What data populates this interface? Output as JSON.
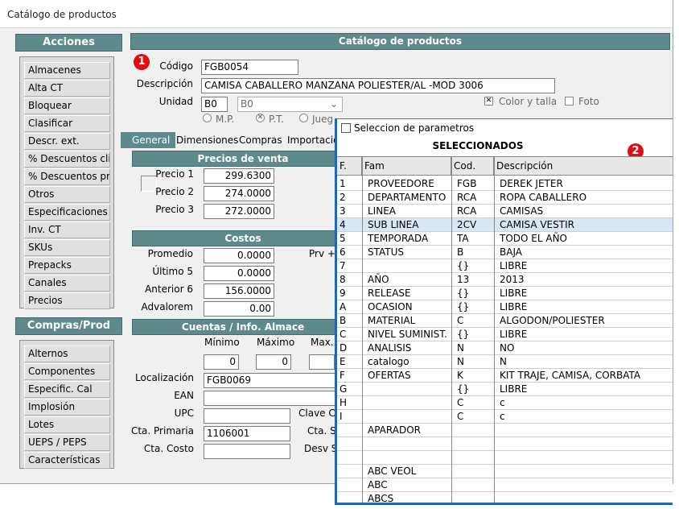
{
  "window": {
    "title": "Catálogo de productos"
  },
  "acciones": {
    "header": "Acciones",
    "items": [
      "Almacenes",
      "Alta CT",
      "Bloquear",
      "Clasificar",
      "Descr. ext.",
      "% Descuentos clis",
      "% Descuentos prvs",
      "Otros",
      "Especificaciones",
      "Inv. CT",
      "SKUs",
      "Prepacks",
      "Canales",
      "Precios"
    ]
  },
  "compras": {
    "header": "Compras/Prod",
    "items": [
      "Alternos",
      "Componentes",
      "Especific. Cal",
      "Implosión",
      "Lotes",
      "UEPS / PEPS",
      "Características"
    ]
  },
  "main": {
    "header": "Catálogo de productos",
    "badge1": "1",
    "codigo_label": "Código",
    "codigo_value": "FGB0054",
    "descripcion_label": "Descripción",
    "descripcion_value": "CAMISA CABALLERO MANZANA POLIESTER/AL  -MOD 3006",
    "unidad_label": "Unidad",
    "unidad_value": "B0",
    "unidad_select": "B0",
    "color_talla_label": "Color y talla",
    "foto_label": "Foto",
    "radio_mp": "M.P.",
    "radio_pt": "P.T.",
    "radio_jue": "Jueg"
  },
  "tabs": {
    "general": "General",
    "dimensiones": "Dimensiones",
    "compras": "Compras",
    "importacion": "Importació"
  },
  "precios": {
    "header": "Precios de venta",
    "labels": [
      "Precio 1",
      "Precio 2",
      "Precio 3"
    ],
    "values": [
      "299.6300",
      "274.0000",
      "272.0000"
    ]
  },
  "costos": {
    "header": "Costos",
    "labels": [
      "Promedio",
      "Último 5",
      "Anterior 6",
      "Advalorem"
    ],
    "values": [
      "0.0000",
      "0.0000",
      "156.0000",
      "0.00"
    ],
    "prv_label": "Prv +"
  },
  "cuentas": {
    "header": "Cuentas / Info. Almace",
    "minimo_label": "Mínimo",
    "maximo_label": "Máximo",
    "max_label": "Max.",
    "minimo_value": "0",
    "maximo_value": "0",
    "localizacion_label": "Localización",
    "localizacion_value": "FGB0069",
    "ean_label": "EAN",
    "upc_label": "UPC",
    "clave_label": "Clave CF",
    "cta_primaria_label": "Cta. Primaria",
    "cta_primaria_value": "1106001",
    "cta_se_label": "Cta. Se",
    "cta_costo_label": "Cta. Costo",
    "desv_label": "Desv St"
  },
  "popup": {
    "checkbox_label": "Seleccion de parametros",
    "title": "SELECCIONADOS",
    "badge2": "2",
    "columns": [
      "F.",
      "Fam",
      "Cod.",
      "Descripción"
    ],
    "rows": [
      [
        "1",
        "PROVEEDORE",
        "FGB",
        "DEREK JETER"
      ],
      [
        "2",
        "DEPARTAMENTO",
        "RCA",
        "ROPA CABALLERO"
      ],
      [
        "3",
        "LINEA",
        "RCA",
        "CAMISAS"
      ],
      [
        "4",
        "SUB LINEA",
        "2CV",
        "CAMISA VESTIR"
      ],
      [
        "5",
        "TEMPORADA",
        "TA",
        "TODO EL AÑO"
      ],
      [
        "6",
        "STATUS",
        "B",
        "BAJA"
      ],
      [
        "7",
        "",
        "{}",
        "LIBRE"
      ],
      [
        "8",
        "AÑO",
        "13",
        "2013"
      ],
      [
        "9",
        "RELEASE",
        "{}",
        "LIBRE"
      ],
      [
        "A",
        "OCASION",
        "{}",
        "LIBRE"
      ],
      [
        "B",
        "MATERIAL",
        "C",
        "ALGODON/POLIESTER"
      ],
      [
        "C",
        "NIVEL SUMINIST.",
        "{}",
        "LIBRE"
      ],
      [
        "D",
        "ANALISIS",
        "N",
        "NO"
      ],
      [
        "E",
        "catalogo",
        "N",
        "N"
      ],
      [
        "F",
        "OFERTAS",
        "K",
        "KIT TRAJE, CAMISA, CORBATA"
      ],
      [
        "G",
        "",
        "{}",
        "LIBRE"
      ],
      [
        "H",
        "",
        "C",
        "c"
      ],
      [
        "I",
        "",
        "C",
        "c"
      ],
      [
        "",
        "APARADOR",
        "",
        ""
      ],
      [
        "",
        "",
        "",
        ""
      ],
      [
        "",
        "",
        "",
        ""
      ],
      [
        "",
        "ABC VEOL",
        "",
        ""
      ],
      [
        "",
        "ABC",
        "",
        ""
      ],
      [
        "",
        "ABCS",
        "",
        ""
      ]
    ]
  }
}
